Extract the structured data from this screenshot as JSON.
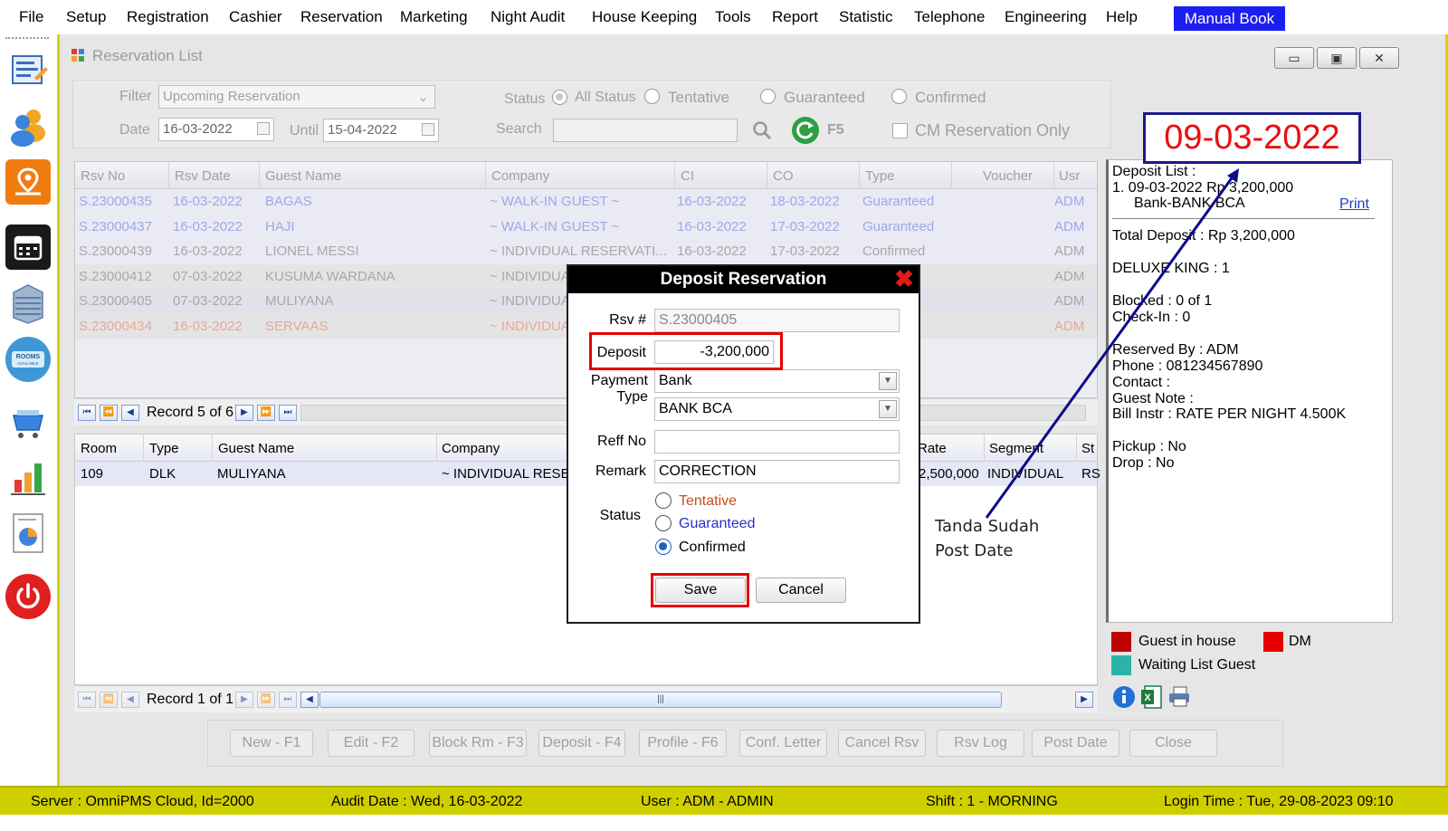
{
  "menu": [
    "File",
    "Setup",
    "Registration",
    "Cashier",
    "Reservation",
    "Marketing",
    "Night Audit",
    "House Keeping",
    "Tools",
    "Report",
    "Statistic",
    "Telephone",
    "Engineering",
    "Help"
  ],
  "menu_manual": "Manual Book",
  "left_toolbar": [
    "notes-icon",
    "users-icon",
    "map-pin-icon",
    "calendar-icon",
    "building-icon",
    "rooms-available-icon",
    "cart-icon",
    "bar-chart-icon",
    "pie-report-icon",
    "power-icon"
  ],
  "window": {
    "title": "Reservation List",
    "min": "▭",
    "max": "▣",
    "close": "✕"
  },
  "filter": {
    "filter_label": "Filter",
    "filter_value": "Upcoming Reservation",
    "date_label": "Date",
    "date_value": "16-03-2022",
    "until_label": "Until",
    "until_value": "15-04-2022",
    "status_label": "Status",
    "status_options": [
      "All Status",
      "Tentative",
      "Guaranteed",
      "Confirmed"
    ],
    "search_label": "Search",
    "search_value": "",
    "refresh_label": "F5",
    "cm_only_label": "CM Reservation Only"
  },
  "rsv_table": {
    "columns": [
      "Rsv No",
      "Rsv Date",
      "Guest Name",
      "Company",
      "CI",
      "CO",
      "Type",
      "Voucher",
      "Usr"
    ],
    "rows": [
      {
        "rsv_no": "S.23000435",
        "rsv_date": "16-03-2022",
        "guest": "BAGAS",
        "company": "~ WALK-IN GUEST ~",
        "ci": "16-03-2022",
        "co": "18-03-2022",
        "type": "Guaranteed",
        "voucher": "",
        "usr": "ADM"
      },
      {
        "rsv_no": "S.23000437",
        "rsv_date": "16-03-2022",
        "guest": "HAJI",
        "company": "~ WALK-IN GUEST ~",
        "ci": "16-03-2022",
        "co": "17-03-2022",
        "type": "Guaranteed",
        "voucher": "",
        "usr": "ADM"
      },
      {
        "rsv_no": "S.23000439",
        "rsv_date": "16-03-2022",
        "guest": "LIONEL MESSI",
        "company": "~ INDIVIDUAL RESERVATI...",
        "ci": "16-03-2022",
        "co": "17-03-2022",
        "type": "Confirmed",
        "voucher": "",
        "usr": "ADM"
      },
      {
        "rsv_no": "S.23000412",
        "rsv_date": "07-03-2022",
        "guest": "KUSUMA WARDANA",
        "company": "~ INDIVIDUA",
        "ci": "",
        "co": "",
        "type": "",
        "voucher": "",
        "usr": "ADM"
      },
      {
        "rsv_no": "S.23000405",
        "rsv_date": "07-03-2022",
        "guest": "MULIYANA",
        "company": "~ INDIVIDUA",
        "ci": "",
        "co": "",
        "type": "",
        "voucher": "",
        "usr": "ADM"
      },
      {
        "rsv_no": "S.23000434",
        "rsv_date": "16-03-2022",
        "guest": "SERVAAS",
        "company": "~ INDIVIDUA",
        "ci": "",
        "co": "",
        "type": "",
        "voucher": "",
        "usr": "ADM"
      }
    ],
    "record_text": "Record 5 of 6"
  },
  "room_table": {
    "columns": [
      "Room",
      "Type",
      "Guest Name",
      "Company",
      "Rate",
      "Segment",
      "St"
    ],
    "rows": [
      {
        "room": "109",
        "type": "DLK",
        "guest": "MULIYANA",
        "company": "~ INDIVIDUAL RESER",
        "rate": "2,500,000",
        "segment": "INDIVIDUAL",
        "st": "RS"
      }
    ],
    "record_text": "Record 1 of 1"
  },
  "buttons": [
    "New - F1",
    "Edit - F2",
    "Block Rm - F3",
    "Deposit - F4",
    "Profile  - F6",
    "Conf. Letter",
    "Cancel Rsv",
    "Rsv Log",
    "Post Date",
    "Close"
  ],
  "right_panel": {
    "deposit_list_label": "Deposit List :",
    "deposit_line": "1. 09-03-2022   Rp 3,200,000",
    "deposit_bank": "Bank-BANK BCA",
    "print": "Print",
    "total_deposit": "Total Deposit : Rp 3,200,000",
    "room_type": "DELUXE KING : 1",
    "blocked": "Blocked : 0 of 1",
    "checkin": "Check-In : 0",
    "reserved_by": "Reserved By : ADM",
    "phone": "Phone : 081234567890",
    "contact": "Contact :",
    "guest_note": "Guest Note :",
    "bill_instr": "Bill Instr : RATE PER NIGHT 4.500K",
    "pickup": "Pickup : No",
    "drop": "Drop : No"
  },
  "legend": {
    "guest_in_house": "Guest in house",
    "guest_in_house_color": "#c00000",
    "dm": "DM",
    "dm_color": "#e60000",
    "waiting_list": "Waiting List Guest",
    "waiting_list_color": "#2ab3a6"
  },
  "dialog": {
    "title": "Deposit Reservation",
    "rsv_label": "Rsv #",
    "rsv_value": "S.23000405",
    "deposit_label": "Deposit",
    "deposit_value": "-3,200,000",
    "payment_label": "Payment",
    "type_label": "Type",
    "payment_value": "Bank",
    "type_value": "BANK BCA",
    "reff_label": "Reff No",
    "reff_value": "",
    "remark_label": "Remark",
    "remark_value": "CORRECTION",
    "status_label": "Status",
    "status_options": [
      "Tentative",
      "Guaranteed",
      "Confirmed"
    ],
    "status_selected": "Confirmed",
    "save": "Save",
    "cancel": "Cancel"
  },
  "annotation": {
    "date": "09-03-2022",
    "note_line1": "Tanda Sudah",
    "note_line2": "Post Date"
  },
  "status_bar": {
    "server": "Server : OmniPMS Cloud, Id=2000",
    "audit_date": "Audit Date : Wed, 16-03-2022",
    "user": "User : ADM - ADMIN",
    "shift": "Shift : 1 - MORNING",
    "login_time": "Login Time : Tue, 29-08-2023 09:10"
  }
}
